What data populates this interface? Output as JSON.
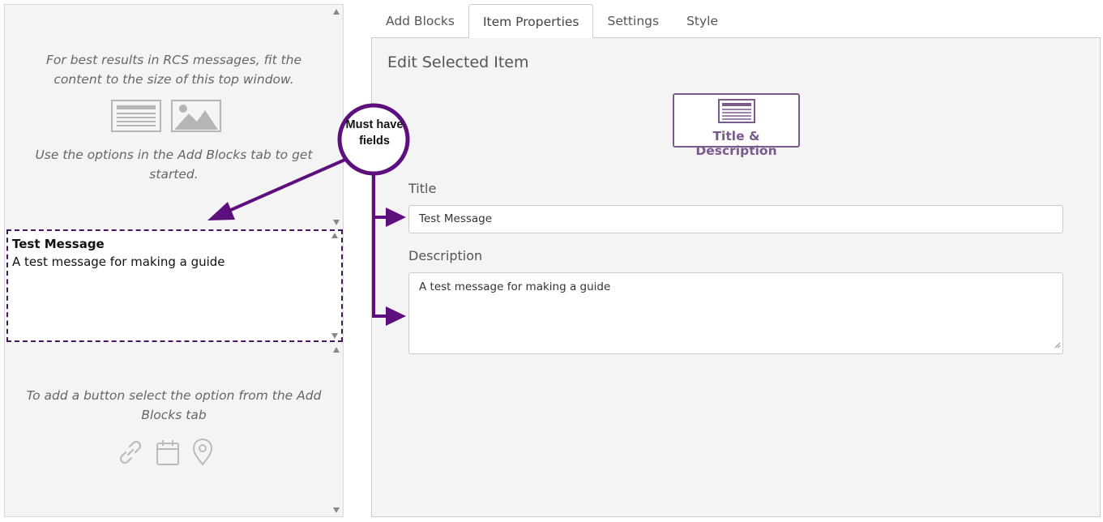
{
  "preview": {
    "top_hint": "For best results in RCS messages, fit the content to the size of this top window.",
    "start_hint": "Use the options in the Add Blocks tab to get started.",
    "button_hint": "To add a button select the option from the Add Blocks tab",
    "card": {
      "title": "Test Message",
      "description": "A test message for making a guide"
    },
    "icons": [
      "text-block-icon",
      "image-icon",
      "link-icon",
      "calendar-icon",
      "location-pin-icon"
    ]
  },
  "tabs": [
    {
      "label": "Add Blocks",
      "active": false
    },
    {
      "label": "Item Properties",
      "active": true
    },
    {
      "label": "Settings",
      "active": false
    },
    {
      "label": "Style",
      "active": false
    }
  ],
  "editor": {
    "heading": "Edit Selected Item",
    "item_type_label": "Title & Description",
    "title_label": "Title",
    "title_value": "Test Message",
    "description_label": "Description",
    "description_value": "A test message for making a guide"
  },
  "annotation": {
    "callout_text": "Must have fields",
    "color": "#5e0f7e"
  },
  "colors": {
    "accent": "#7a5a8c",
    "dashed_border": "#4a1560",
    "panel_bg": "#f4f4f4"
  }
}
